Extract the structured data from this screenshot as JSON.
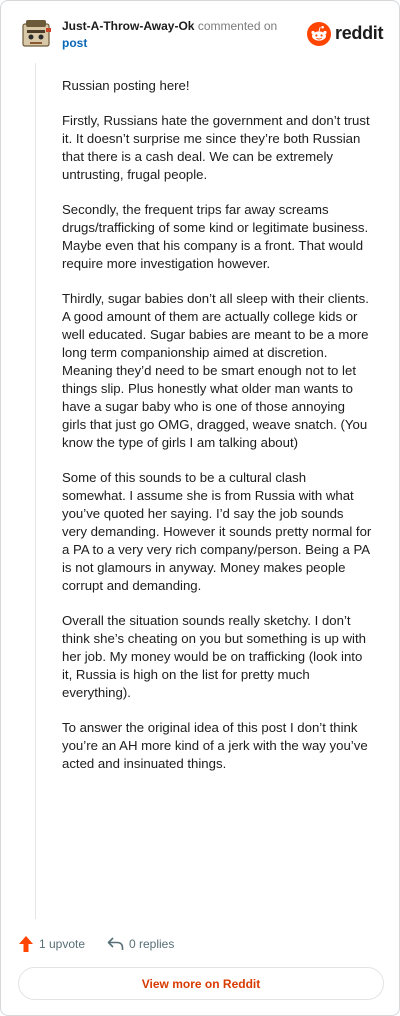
{
  "comment": {
    "username": "Just-A-Throw-Away-Ok",
    "commented_text": "commented on",
    "post_link_label": "post",
    "paragraphs": [
      "Russian posting here!",
      "Firstly, Russians hate the government and don’t trust it. It doesn’t surprise me since they’re both Russian that there is a cash deal. We can be extremely untrusting, frugal people.",
      "Secondly, the frequent trips far away screams drugs/trafficking of some kind or legitimate business. Maybe even that his company is a front. That would require more investigation however.",
      "Thirdly, sugar babies don’t all sleep with their clients. A good amount of them are actually college kids or well educated. Sugar babies are meant to be a more long term companionship aimed at discretion. Meaning they’d need to be smart enough not to let things slip. Plus honestly what older man wants to have a sugar baby who is one of those annoying girls that just go OMG, dragged, weave snatch. (You know the type of girls I am talking about)",
      "Some of this sounds to be a cultural clash somewhat. I assume she is from Russia with what you’ve quoted her saying. I’d say the job sounds very demanding. However it sounds pretty normal for a PA to a very very rich company/person. Being a PA is not glamours in anyway. Money makes people corrupt and demanding.",
      "Overall the situation sounds really sketchy. I don’t think she’s cheating on you but something is up with her job. My money would be on trafficking (look into it, Russia is high on the list for pretty much everything).",
      "To answer the original idea of this post I don’t think you’re an AH more kind of a jerk with the way you’ve acted and insinuated things."
    ],
    "upvotes_label": "1 upvote",
    "replies_label": "0 replies"
  },
  "brand": {
    "name": "reddit",
    "accent_color": "#ff4500"
  },
  "footer": {
    "view_more_label": "View more on Reddit"
  },
  "icons": {
    "avatar": "avatar-image",
    "logo": "reddit-logo-icon",
    "upvote": "upvote-arrow-icon",
    "reply": "reply-arrow-icon"
  }
}
